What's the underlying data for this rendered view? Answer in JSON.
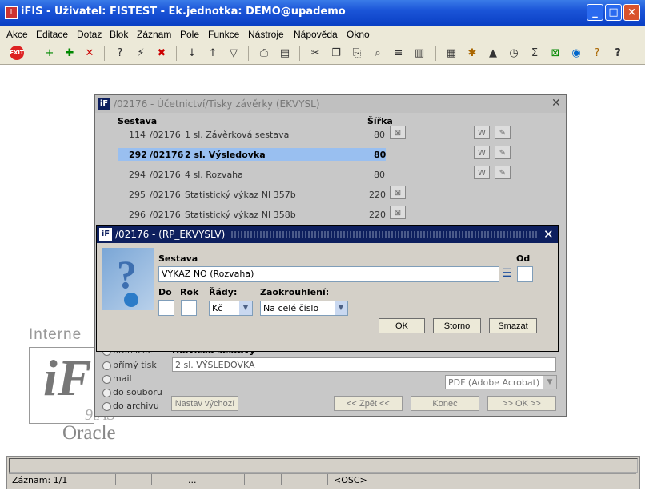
{
  "window": {
    "title": "iFIS - Uživatel: FISTEST - Ek.jednotka: DEMO@upademo",
    "app_icon": "iFIS-icon"
  },
  "menu": [
    "Akce",
    "Editace",
    "Dotaz",
    "Blok",
    "Záznam",
    "Pole",
    "Funkce",
    "Nástroje",
    "Nápověda",
    "Okno"
  ],
  "bg_form": {
    "title": "/02176 - Účetnictví/Tisky závěrky (EKVYSL)",
    "col_sestava": "Sestava",
    "col_sirka": "Šířka",
    "rows": [
      {
        "num": "114",
        "code": "/02176",
        "name": "1 sl. Závěrková sestava",
        "width": "80"
      },
      {
        "num": "292",
        "code": "/02176",
        "name": "2 sl. Výsledovka",
        "width": "80"
      },
      {
        "num": "294",
        "code": "/02176",
        "name": "4 sl. Rozvaha",
        "width": "80"
      },
      {
        "num": "295",
        "code": "/02176",
        "name": "Statistický výkaz NI 357b",
        "width": "220"
      },
      {
        "num": "296",
        "code": "/02176",
        "name": "Statistický výkaz NI 358b",
        "width": "220"
      }
    ],
    "radio_options": [
      "prohlížeč",
      "přímý tisk",
      "mail",
      "do souboru",
      "do archivu"
    ],
    "heading_label": "Hlavička sestavy",
    "heading_value": "2 sl. VÝSLEDOVKA",
    "format_value": "PDF (Adobe Acrobat)",
    "btn_reset": "Nastav výchozí",
    "btn_back": "<< Zpět <<",
    "btn_end": "Konec",
    "btn_ok": ">> OK >>"
  },
  "logo": {
    "top": "Interne",
    "brand": "iF",
    "line1": "9iAS",
    "line2": "Oracle"
  },
  "modal": {
    "title": "/02176 - (RP_EKVYSLV)",
    "lbl_sestava": "Sestava",
    "lbl_od": "Od",
    "sestava_value": "VÝKAZ NO (Rozvaha)",
    "lbl_do": "Do",
    "lbl_rok": "Rok",
    "lbl_rady": "Řády:",
    "lbl_zaokrouhleni": "Zaokrouhlení:",
    "rady_value": "Kč",
    "zaokr_value": "Na celé číslo",
    "btn_ok": "OK",
    "btn_storno": "Storno",
    "btn_smazat": "Smazat"
  },
  "status": {
    "record": "Záznam: 1/1",
    "dots": "...",
    "osc": "<OSC>"
  }
}
